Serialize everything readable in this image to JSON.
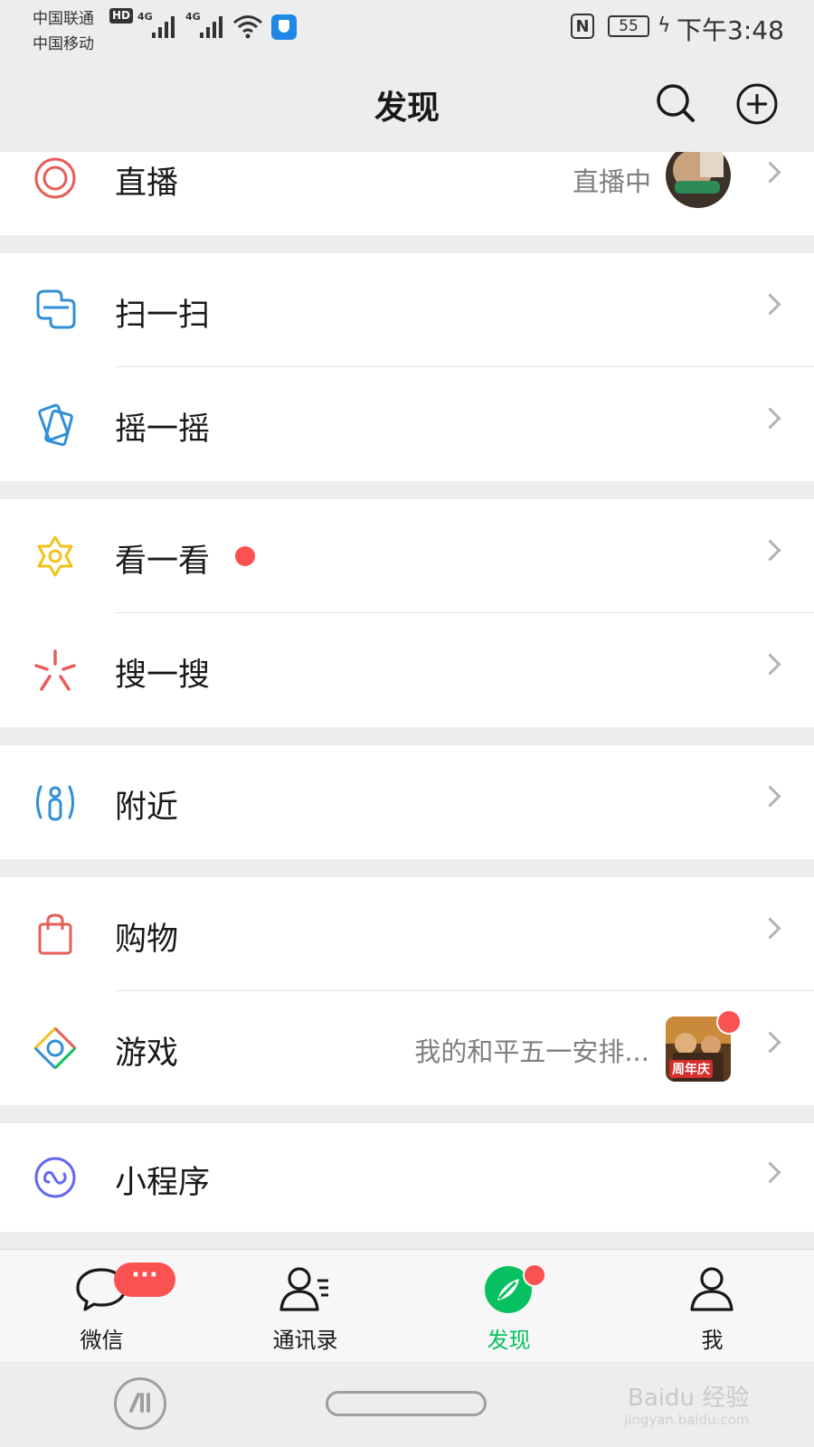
{
  "status_bar": {
    "carrier_1": "中国联通",
    "carrier_2": "中国移动",
    "hd_badge": "HD",
    "network_1": "4G",
    "network_2": "4G",
    "nfc": "N",
    "battery": "55",
    "time": "下午3:48"
  },
  "header": {
    "title": "发现",
    "icons": [
      "search-icon",
      "add-circle-icon"
    ]
  },
  "sections": [
    {
      "items": [
        {
          "label": "直播",
          "extra": "直播中",
          "icon": "live-icon",
          "has_thumbnail": true,
          "has_dot_badge": true
        }
      ]
    },
    {
      "items": [
        {
          "label": "扫一扫",
          "icon": "scan-icon"
        },
        {
          "label": "摇一摇",
          "icon": "shake-icon"
        }
      ]
    },
    {
      "items": [
        {
          "label": "看一看",
          "icon": "top-stories-icon",
          "has_dot_badge": true
        },
        {
          "label": "搜一搜",
          "icon": "search-feature-icon"
        }
      ]
    },
    {
      "items": [
        {
          "label": "附近",
          "icon": "nearby-icon"
        }
      ]
    },
    {
      "items": [
        {
          "label": "购物",
          "icon": "shopping-bag-icon"
        },
        {
          "label": "游戏",
          "extra": "我的和平五一安排...",
          "icon": "game-icon",
          "has_thumbnail": true,
          "thumbnail_text": "周年庆",
          "has_dot_badge": true
        }
      ]
    },
    {
      "items": [
        {
          "label": "小程序",
          "icon": "mini-program-icon"
        }
      ]
    }
  ],
  "tabs": [
    {
      "label": "微信",
      "icon": "chat-icon",
      "badge": "···"
    },
    {
      "label": "通讯录",
      "icon": "contacts-icon"
    },
    {
      "label": "发现",
      "icon": "discover-icon",
      "active": true
    },
    {
      "label": "我",
      "icon": "me-icon"
    }
  ],
  "watermark": {
    "text": "Baidu 经验",
    "sub": "jingyan.baidu.com"
  },
  "colors": {
    "background": "#ededed",
    "active_tab": "#07c160",
    "badge": "#fa5151",
    "chevron": "#b2b2b2"
  }
}
